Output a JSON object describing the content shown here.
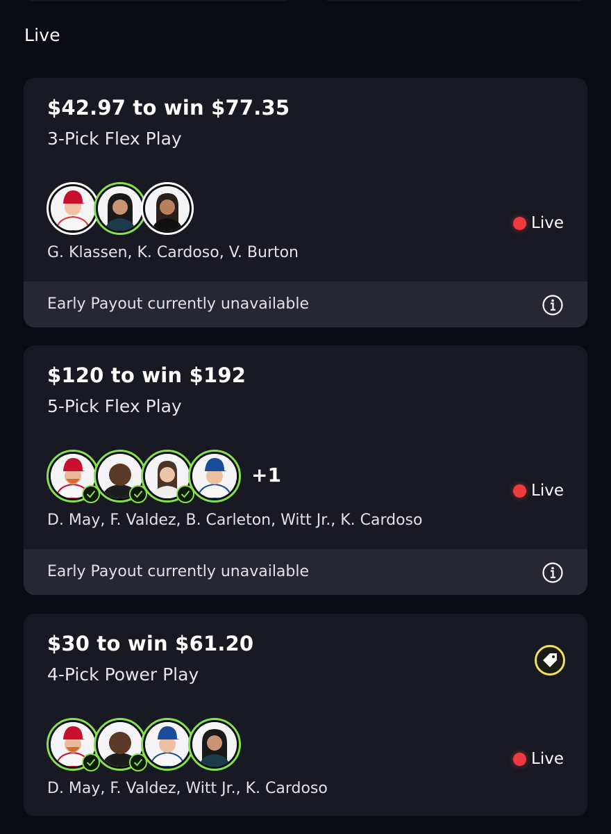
{
  "section": {
    "title": "Live"
  },
  "cards": [
    {
      "title": "$42.97 to win $77.35",
      "subtitle": "3-Pick Flex Play",
      "status": "Live",
      "players": "G. Klassen, K. Cardoso, V. Burton",
      "footer": "Early Payout currently unavailable"
    },
    {
      "title": "$120 to win $192",
      "subtitle": "5-Pick Flex Play",
      "status": "Live",
      "more": "+1",
      "players": "D. May, F. Valdez, B. Carleton, Witt Jr., K. Cardoso",
      "footer": "Early Payout currently unavailable"
    },
    {
      "title": "$30 to win $61.20",
      "subtitle": "4-Pick Power Play",
      "status": "Live",
      "players": "D. May, F. Valdez, Witt Jr., K. Cardoso"
    }
  ],
  "colors": {
    "background": "#0b0c13",
    "card": "#181922",
    "accent_green": "#86e24c",
    "live_red": "#ef3b3f",
    "promo_yellow": "#f0e25c"
  },
  "icons": [
    "info-icon",
    "price-tag-icon",
    "checkmark-icon",
    "live-dot-icon"
  ]
}
